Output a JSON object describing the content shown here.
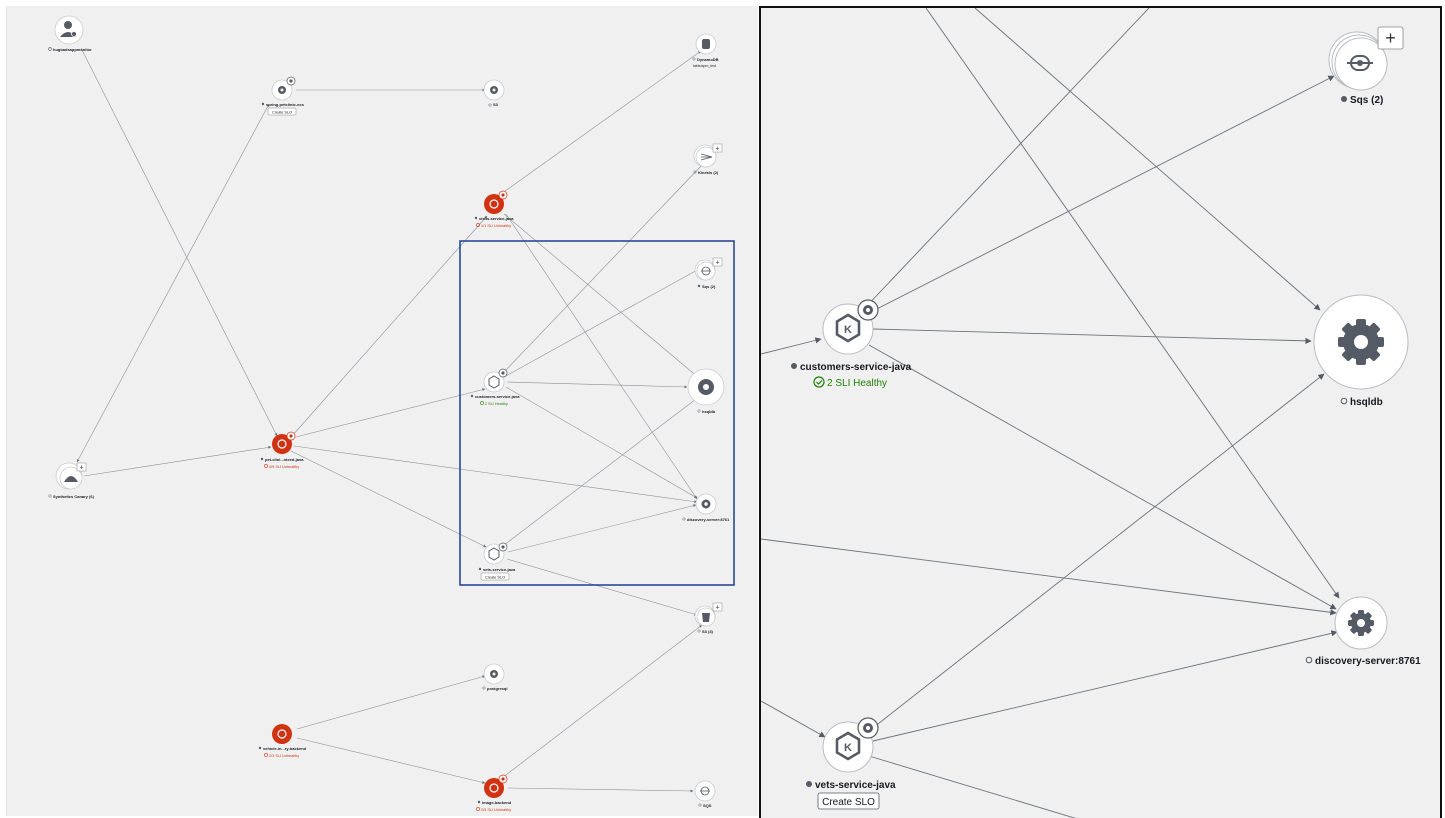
{
  "overview": {
    "nodes": {
      "hugbadcanary": {
        "label": "hugbadsappmonitor"
      },
      "spring_petclinic": {
        "label": "spring-petclinic-ecs",
        "action": "Create SLO"
      },
      "s3_top": {
        "label": "S3"
      },
      "dynamodb": {
        "label": "DynamoDB",
        "sublabel": "table/apm_test"
      },
      "kinesis": {
        "label": "Kinesis (2)"
      },
      "visits": {
        "label": "visits-service-java",
        "status": "1/1 SLI Unhealthy"
      },
      "sqs_mini": {
        "label": "Sqs (2)"
      },
      "customers_mini": {
        "label": "customers-service-java",
        "status": "2 SLI Healthy"
      },
      "hsqldb_mini": {
        "label": "hsqldb"
      },
      "discovery_mini": {
        "label": "discovery-server:8761"
      },
      "vets_mini": {
        "label": "vets-service-java",
        "action": "Create SLO"
      },
      "pet_clinic": {
        "label": "pet-clini...nteed-java",
        "status": "4/9 SLI Unhealthy"
      },
      "synthetics": {
        "label": "Synthetics Canary (6)"
      },
      "s3_bottom": {
        "label": "S3 (3)"
      },
      "postgresql": {
        "label": "postgresql"
      },
      "vehicle": {
        "label": "vehicle-in...ry-backend",
        "status": "2/3 SLI Unhealthy"
      },
      "image_backend": {
        "label": "image-backend",
        "status": "0/5 SLI Unhealthy"
      },
      "sqs_bottom": {
        "label": "SQS"
      }
    }
  },
  "detail": {
    "sqs": {
      "label": "Sqs (2)"
    },
    "customers": {
      "label": "customers-service-java",
      "status": "2 SLI Healthy"
    },
    "hsqldb": {
      "label": "hsqldb"
    },
    "discovery": {
      "label": "discovery-server:8761"
    },
    "vets": {
      "label": "vets-service-java",
      "action": "Create SLO"
    }
  },
  "colors": {
    "unhealthy": "#d13212",
    "healthy": "#1d8102",
    "edge": "#687078",
    "node_icon": "#545b64",
    "highlight_box": "#1f3d8f"
  },
  "icons": {
    "service": "eks-k-icon",
    "resource": "gear-icon",
    "user": "user-group-icon",
    "canary": "canary-icon",
    "sqs": "queue-icon",
    "kinesis": "kinesis-stream-icon",
    "bucket": "bucket-icon",
    "dynamodb": "database-icon"
  }
}
